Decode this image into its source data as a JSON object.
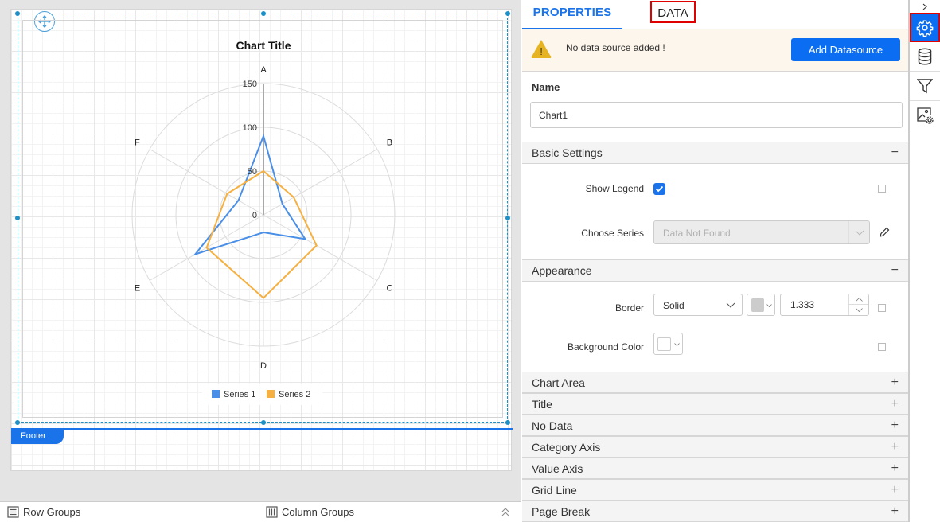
{
  "designer": {
    "footer_label": "Footer",
    "bottom_bar": {
      "row_groups": "Row Groups",
      "column_groups": "Column Groups"
    }
  },
  "chart_data": {
    "type": "radar",
    "title": "Chart Title",
    "categories": [
      "A",
      "B",
      "C",
      "D",
      "E",
      "F"
    ],
    "axis": {
      "min": 0,
      "max": 150,
      "interval": 50,
      "tick_labels": [
        "0",
        "50",
        "100",
        "150"
      ]
    },
    "series": [
      {
        "name": "Series 1",
        "color": "#4a8fe7",
        "values": [
          90,
          25,
          55,
          20,
          90,
          33
        ]
      },
      {
        "name": "Series 2",
        "color": "#f5b041",
        "values": [
          50,
          40,
          70,
          95,
          75,
          48
        ]
      }
    ],
    "legend_position": "bottom",
    "grid": true
  },
  "panel": {
    "tabs": [
      {
        "label": "PROPERTIES",
        "active": true
      },
      {
        "label": "DATA",
        "active": false
      }
    ],
    "warning": {
      "text": "No data source added !",
      "button": "Add Datasource"
    },
    "name": {
      "label": "Name",
      "value": "Chart1"
    },
    "basic_settings": {
      "title": "Basic Settings",
      "toggle": "−",
      "show_legend_label": "Show Legend",
      "show_legend_checked": true,
      "choose_series_label": "Choose Series",
      "choose_series_placeholder": "Data Not Found"
    },
    "appearance": {
      "title": "Appearance",
      "toggle": "−",
      "border_label": "Border",
      "border_style": "Solid",
      "border_color": "#cccccc",
      "border_width": "1.333",
      "background_label": "Background Color",
      "background_color": "#ffffff"
    },
    "collapsed_sections": [
      {
        "title": "Chart Area",
        "toggle": "+"
      },
      {
        "title": "Title",
        "toggle": "+"
      },
      {
        "title": "No Data",
        "toggle": "+"
      },
      {
        "title": "Category Axis",
        "toggle": "+"
      },
      {
        "title": "Value Axis",
        "toggle": "+"
      },
      {
        "title": "Grid Line",
        "toggle": "+"
      },
      {
        "title": "Page Break",
        "toggle": "+"
      }
    ]
  },
  "icon_strip": {
    "items": [
      "collapse-chevron",
      "properties-gear",
      "data-database",
      "filter",
      "image-settings"
    ],
    "active": "properties-gear"
  }
}
